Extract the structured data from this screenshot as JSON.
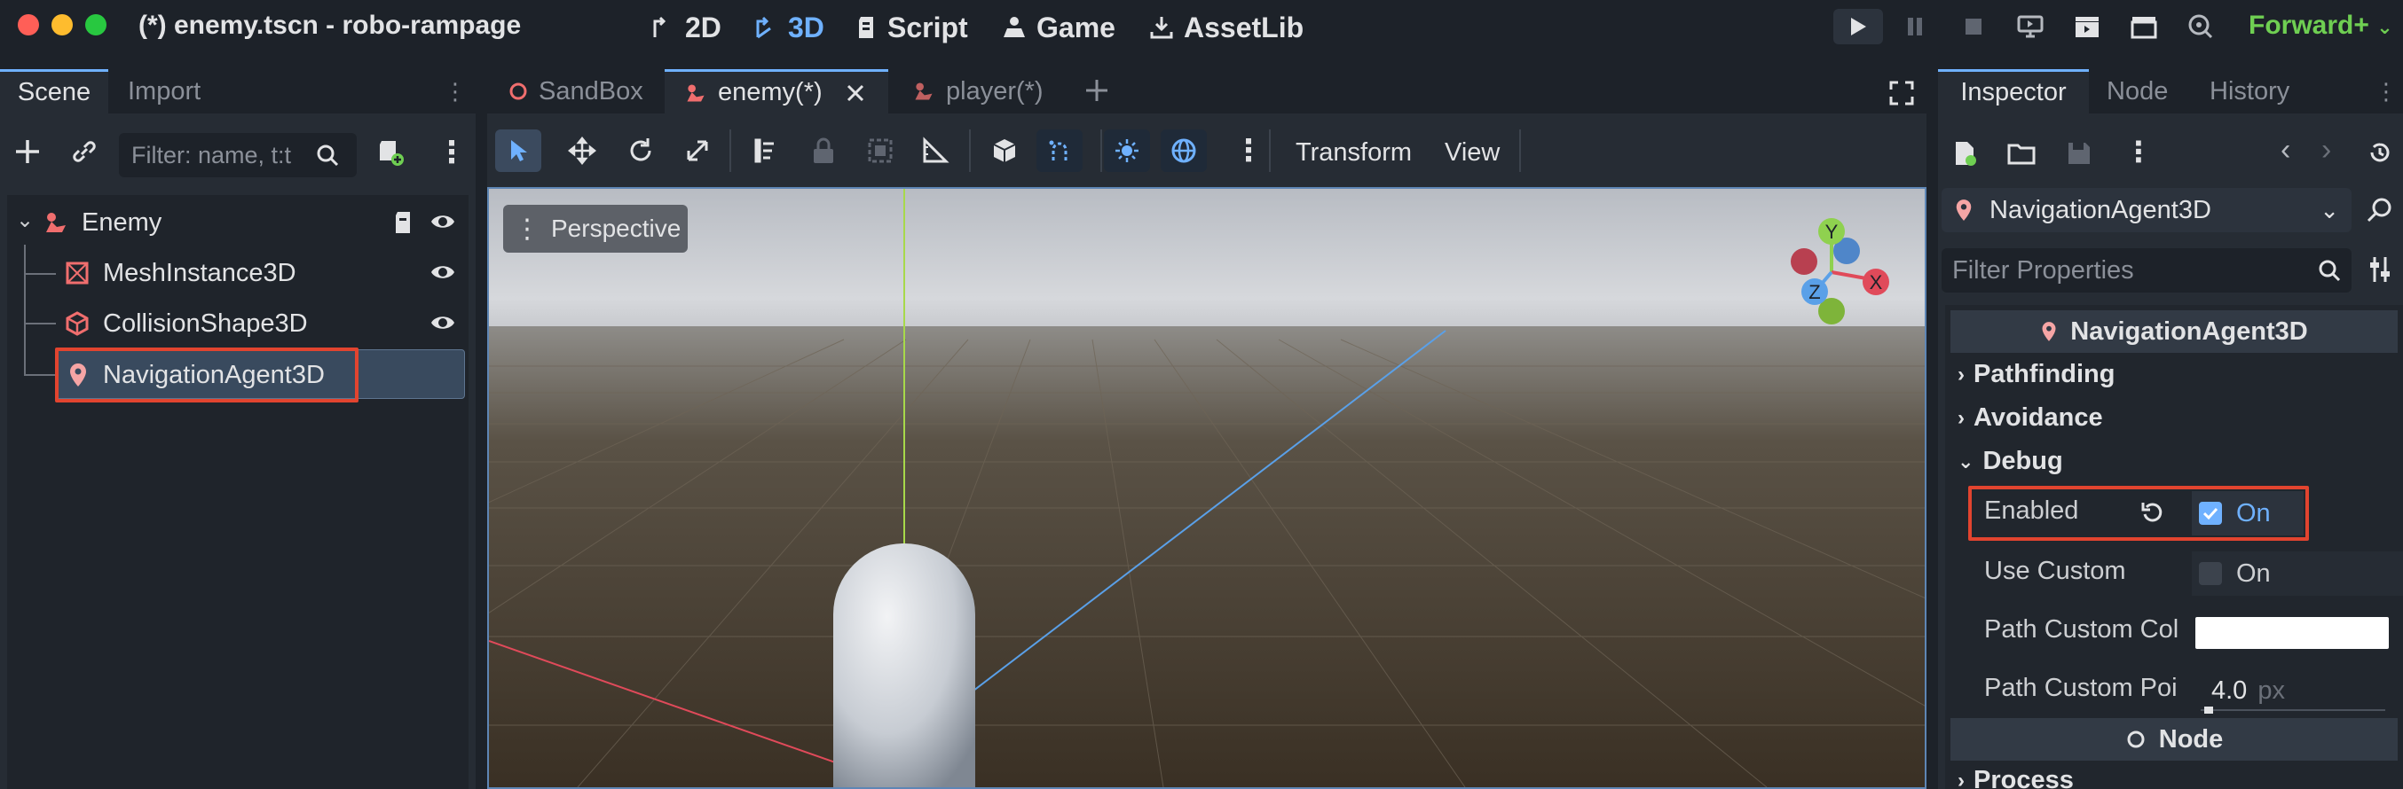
{
  "window": {
    "title": "(*) enemy.tscn - robo-rampage"
  },
  "main_modes": [
    {
      "label": "2D",
      "icon": "2d-icon",
      "active": false
    },
    {
      "label": "3D",
      "icon": "3d-icon",
      "active": true
    },
    {
      "label": "Script",
      "icon": "script-icon",
      "active": false
    },
    {
      "label": "Game",
      "icon": "game-icon",
      "active": false
    },
    {
      "label": "AssetLib",
      "icon": "assetlib-icon",
      "active": false
    }
  ],
  "renderer": {
    "label": "Forward+"
  },
  "left_dock": {
    "tabs": [
      "Scene",
      "Import"
    ],
    "filter_placeholder": "Filter: name, t:t",
    "tree": [
      {
        "label": "Enemy",
        "icon": "enemy-node-icon"
      },
      {
        "label": "MeshInstance3D",
        "icon": "mesh-icon"
      },
      {
        "label": "CollisionShape3D",
        "icon": "collision-icon"
      },
      {
        "label": "NavigationAgent3D",
        "icon": "navigation-agent-icon",
        "selected": true
      }
    ]
  },
  "editor_tabs": [
    {
      "label": "SandBox",
      "icon": "circle-icon"
    },
    {
      "label": "enemy(*)",
      "icon": "enemy-node-icon",
      "active": true
    },
    {
      "label": "player(*)",
      "icon": "player-node-icon"
    }
  ],
  "viewport_toolbar": {
    "transform_label": "Transform",
    "view_label": "View"
  },
  "viewport": {
    "perspective_label": "Perspective",
    "gizmo": {
      "y": "Y",
      "x": "X",
      "z": "Z"
    }
  },
  "right_dock": {
    "tabs": [
      "Inspector",
      "Node",
      "History"
    ],
    "object_selector": "NavigationAgent3D",
    "filter_placeholder": "Filter Properties",
    "section_title": "NavigationAgent3D",
    "groups": {
      "pathfinding": "Pathfinding",
      "avoidance": "Avoidance",
      "debug": "Debug"
    },
    "props": {
      "enabled_label": "Enabled",
      "enabled_value": "On",
      "use_custom_label": "Use Custom",
      "use_custom_value": "On",
      "path_custom_color_label": "Path Custom Col",
      "path_custom_point_label": "Path Custom Poi",
      "path_custom_point_value": "4.0",
      "path_custom_point_unit": "px"
    },
    "node_section_title": "Node",
    "process_group": "Process"
  },
  "colors": {
    "accent": "#6fb1ff",
    "highlight": "#e2442f",
    "node_red": "#f06e6e",
    "renderer_green": "#6fcf52"
  }
}
